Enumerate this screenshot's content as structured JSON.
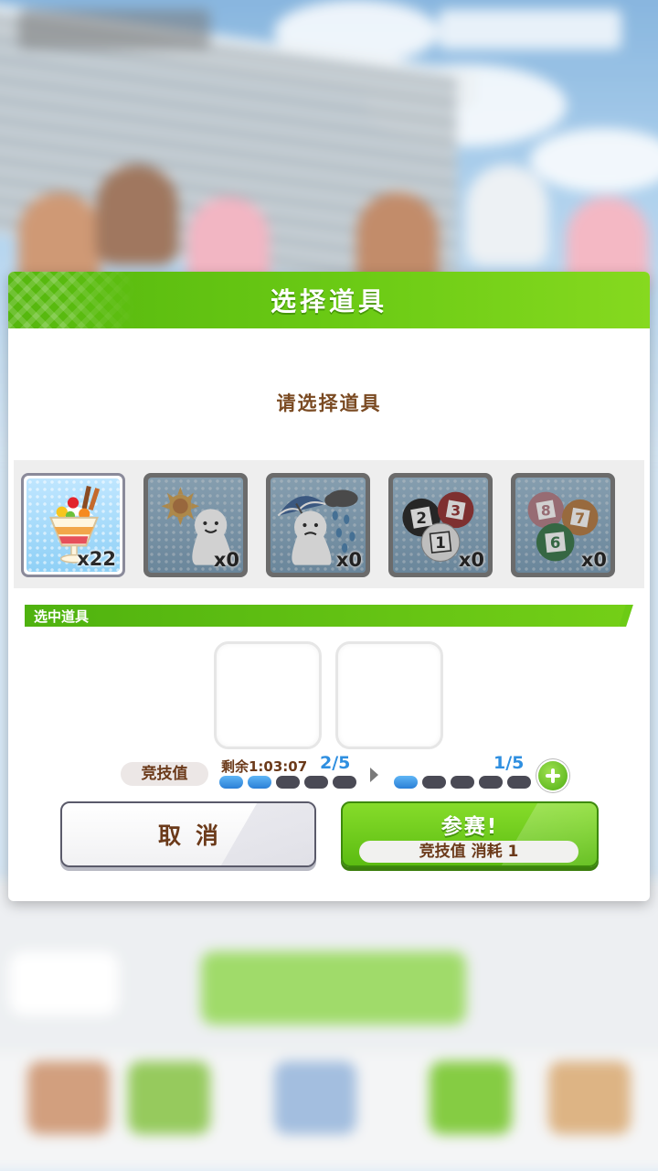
{
  "dialog": {
    "title": "选择道具",
    "prompt": "请选择道具"
  },
  "items": [
    {
      "icon": "parfait-icon",
      "count": "x22",
      "selected": true
    },
    {
      "icon": "sunny-charm-icon",
      "count": "x0",
      "selected": false
    },
    {
      "icon": "rainy-charm-icon",
      "count": "x0",
      "selected": false
    },
    {
      "icon": "lottery-balls-123-icon",
      "count": "x0",
      "selected": false
    },
    {
      "icon": "lottery-balls-678-icon",
      "count": "x0",
      "selected": false
    }
  ],
  "selected_section": {
    "label": "选中道具",
    "slot_count": 2
  },
  "stamina": {
    "label": "竞技值",
    "remaining": "剩余1:03:07",
    "current_ratio": "2/5",
    "current_filled": 2,
    "after_ratio": "1/5",
    "after_filled": 1,
    "max": 5
  },
  "buttons": {
    "cancel": "取消",
    "join": "参赛!",
    "join_cost": "竞技值 消耗 1"
  },
  "colors": {
    "header_green": "#6ccb15",
    "brown_text": "#6b3a1a",
    "blue_accent": "#2f8fe0"
  }
}
